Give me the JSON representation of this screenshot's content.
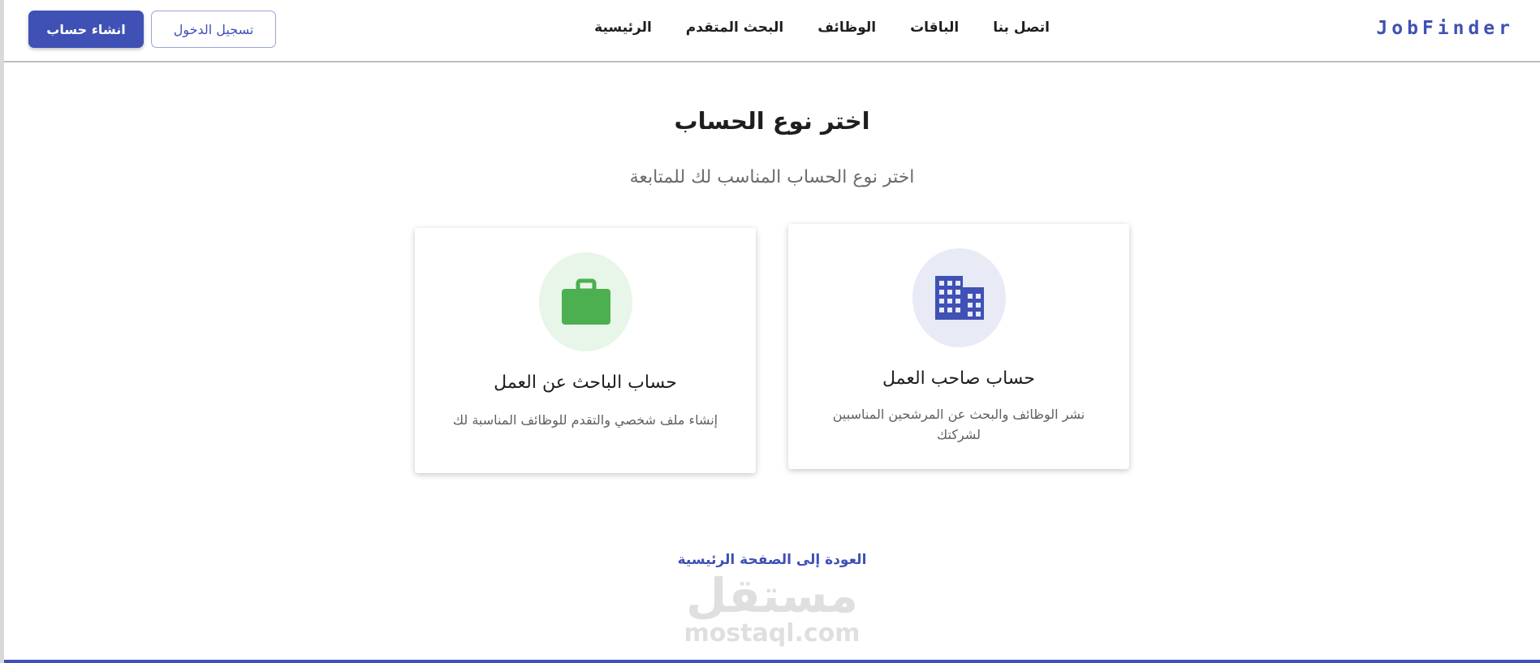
{
  "header": {
    "logo": "JobFinder",
    "nav": [
      "الرئيسية",
      "البحث المتقدم",
      "الوظائف",
      "الباقات",
      "اتصل بنا"
    ],
    "login_label": "تسجيل الدخول",
    "signup_label": "انشاء حساب"
  },
  "main": {
    "title": "اختر نوع الحساب",
    "subtitle": "اختر نوع الحساب المناسب لك للمتابعة",
    "cards": {
      "seeker": {
        "icon": "briefcase-icon",
        "title": "حساب الباحث عن العمل",
        "description": "إنشاء ملف شخصي والتقدم للوظائف المناسبة لك"
      },
      "employer": {
        "icon": "building-icon",
        "title": "حساب صاحب العمل",
        "description": "نشر الوظائف والبحث عن المرشحين المناسبين لشركتك"
      }
    },
    "back_link": "العودة إلى الصفحة الرئيسية"
  },
  "watermark": {
    "arabic": "مستقل",
    "latin": "mostaql.com"
  },
  "colors": {
    "accent": "#3f51b5",
    "success": "#4caf50",
    "success_bg": "#e8f5e9",
    "accent_bg": "#e8eaf6"
  }
}
